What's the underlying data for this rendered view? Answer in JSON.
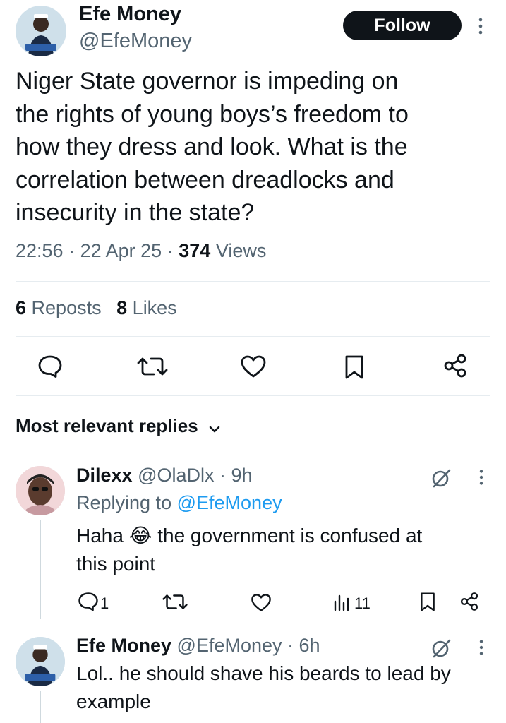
{
  "tweet": {
    "author_name": "Efe Money",
    "author_handle": "@EfeMoney",
    "follow_label": "Follow",
    "text_lines": [
      "Niger State governor is impeding on",
      "the rights of young boys’s freedom to",
      "how they dress and look. What is the",
      "correlation between dreadlocks and",
      "insecurity in the state?"
    ],
    "time": "22:56",
    "date": "22 Apr 25",
    "views_count": "374",
    "views_label": "Views",
    "reposts_count": "6",
    "reposts_label": "Reposts",
    "likes_count": "8",
    "likes_label": "Likes",
    "separator": "·"
  },
  "replies_header": {
    "label": "Most relevant replies"
  },
  "replies": [
    {
      "author_name": "Dilexx",
      "author_handle": "@OlaDlx",
      "age": "· 9h",
      "replying_prefix": "Replying to",
      "replying_to": "@EfeMoney",
      "text_before_emoji": "Haha",
      "emoji": "😂",
      "text_after_emoji": " the government is confused at",
      "text_line2": "this point",
      "reply_count": "1",
      "views_count": "11"
    },
    {
      "author_name": "Efe Money",
      "author_handle": "@EfeMoney",
      "age": "· 6h",
      "text_lines": [
        "Lol.. he should shave his beards to lead by",
        "example"
      ]
    }
  ],
  "colors": {
    "text": "#0f1419",
    "muted": "#536471",
    "link": "#1d9bf0",
    "divider": "#e6ecf0",
    "button_bg": "#0f1419"
  },
  "icons": [
    "reply-icon",
    "repost-icon",
    "like-icon",
    "bookmark-icon",
    "share-icon",
    "grok-icon",
    "more-icon",
    "chevron-down-icon",
    "views-icon"
  ]
}
